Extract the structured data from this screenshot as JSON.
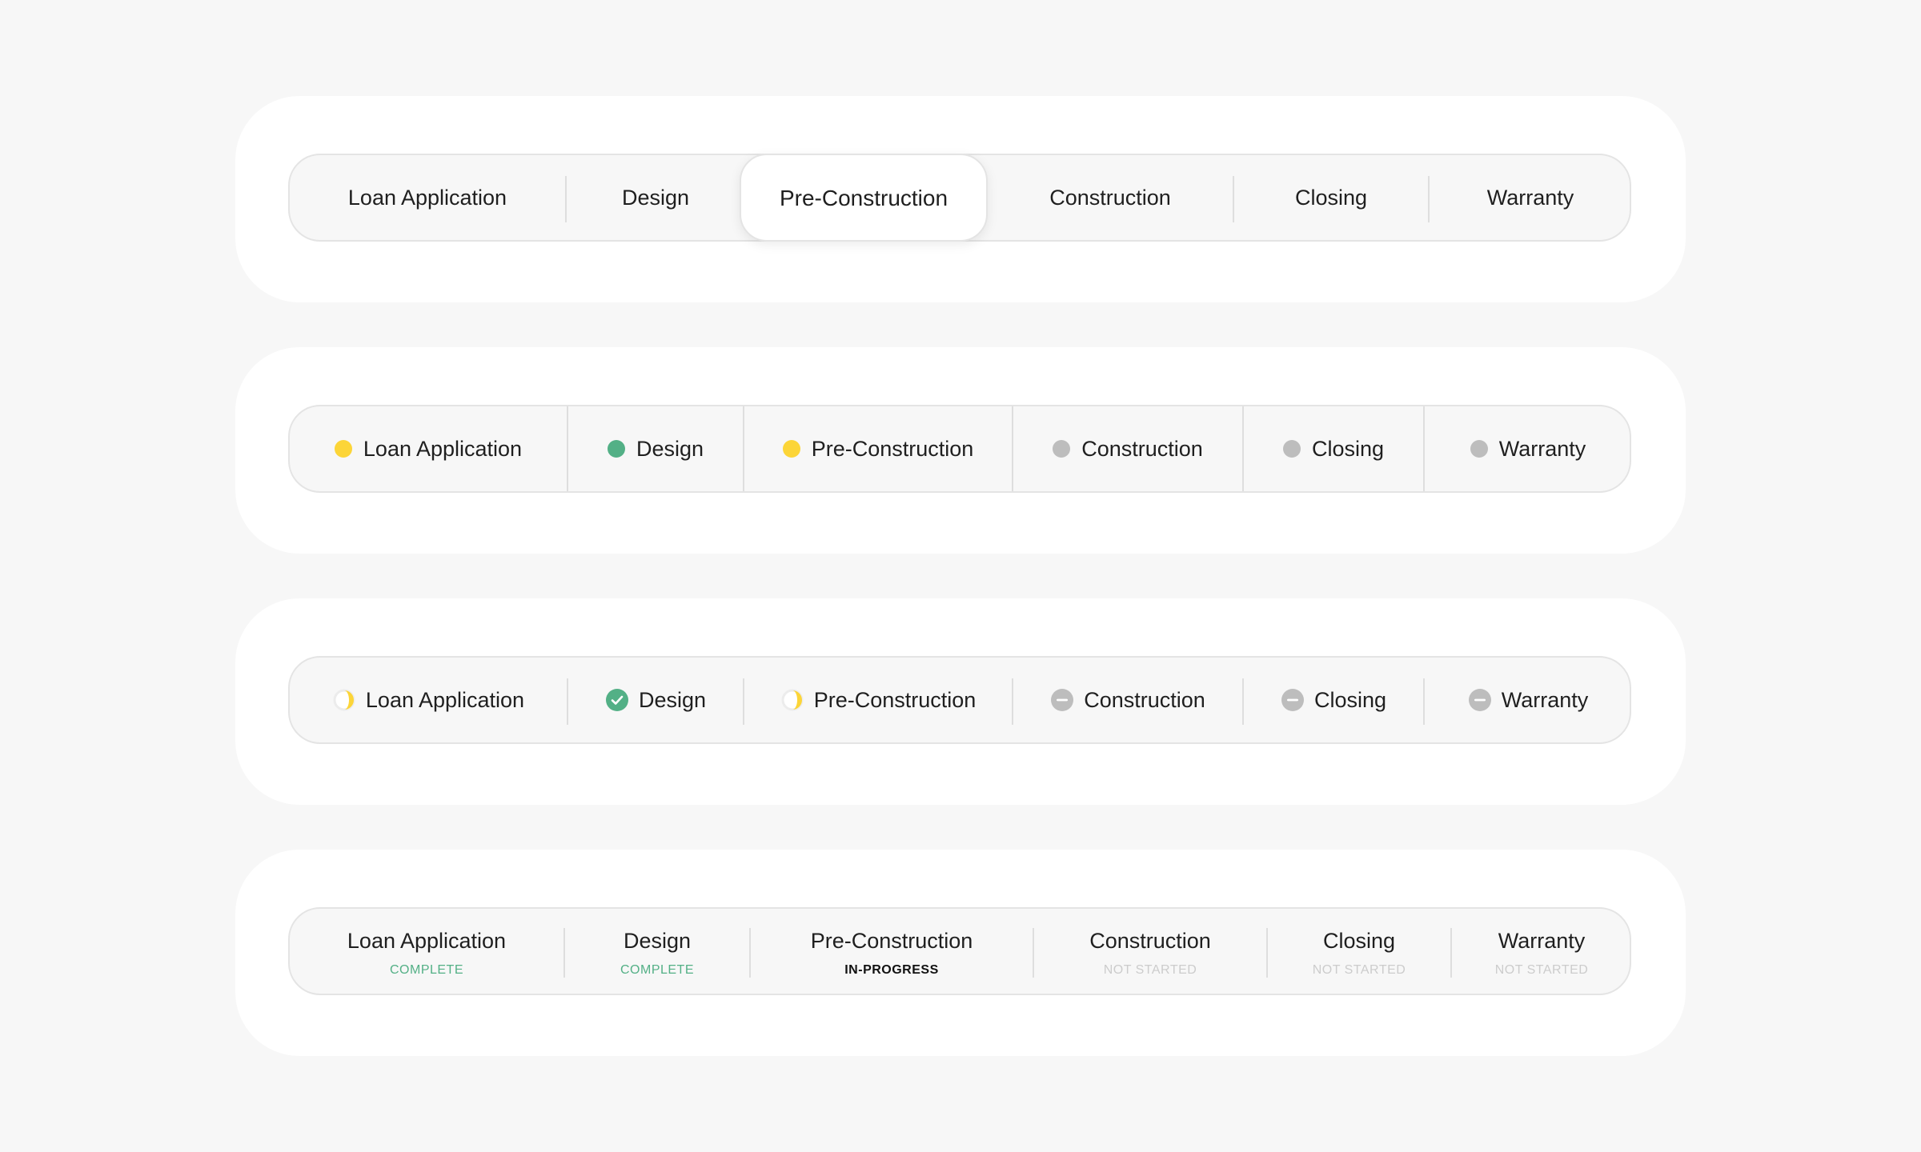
{
  "colors": {
    "complete": "#53b086",
    "in_progress": "#fcd538",
    "not_started": "#bdbdbd",
    "in_progress_text": "#111111",
    "not_started_text": "#cccccc"
  },
  "stages": [
    {
      "label": "Loan Application",
      "state": "in-progress",
      "status": "COMPLETE"
    },
    {
      "label": "Design",
      "state": "complete",
      "status": "COMPLETE"
    },
    {
      "label": "Pre-Construction",
      "state": "in-progress",
      "status": "IN-PROGRESS"
    },
    {
      "label": "Construction",
      "state": "not-started",
      "status": "NOT STARTED"
    },
    {
      "label": "Closing",
      "state": "not-started",
      "status": "NOT STARTED"
    },
    {
      "label": "Warranty",
      "state": "not-started",
      "status": "NOT STARTED"
    }
  ],
  "active_tab": "Pre-Construction"
}
